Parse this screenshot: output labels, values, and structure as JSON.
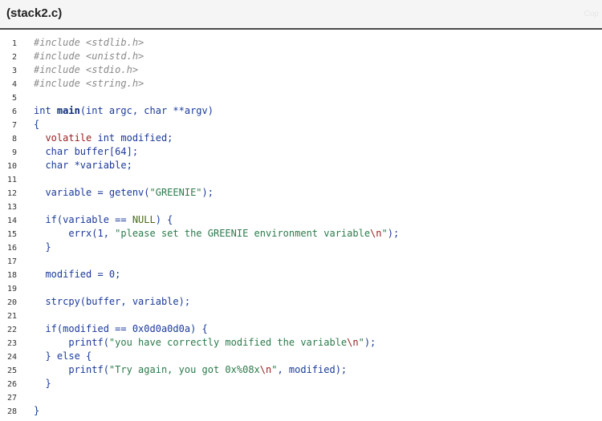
{
  "window": {
    "title": "(stack2.c)",
    "corner_label": "Cop"
  },
  "colors": {
    "keyword": "#1b3a9a",
    "preprocessor": "#8a8a8a",
    "string": "#2b7a4b",
    "escape": "#9b1c1c",
    "volatile": "#9b1c1c"
  },
  "code": {
    "lines": [
      {
        "num": "1",
        "tokens": [
          {
            "t": "#include <stdlib.h>",
            "c": "pp"
          }
        ]
      },
      {
        "num": "2",
        "tokens": [
          {
            "t": "#include <unistd.h>",
            "c": "pp"
          }
        ]
      },
      {
        "num": "3",
        "tokens": [
          {
            "t": "#include <stdio.h>",
            "c": "pp"
          }
        ]
      },
      {
        "num": "4",
        "tokens": [
          {
            "t": "#include <string.h>",
            "c": "pp"
          }
        ]
      },
      {
        "num": "5",
        "tokens": []
      },
      {
        "num": "6",
        "tokens": [
          {
            "t": "int ",
            "c": "kw"
          },
          {
            "t": "main",
            "c": "fn"
          },
          {
            "t": "(int argc, char **argv)",
            "c": "plain"
          }
        ]
      },
      {
        "num": "7",
        "tokens": [
          {
            "t": "{",
            "c": "plain"
          }
        ]
      },
      {
        "num": "8",
        "tokens": [
          {
            "t": "  ",
            "c": "plain"
          },
          {
            "t": "volatile",
            "c": "kwred"
          },
          {
            "t": " int modified;",
            "c": "plain"
          }
        ]
      },
      {
        "num": "9",
        "tokens": [
          {
            "t": "  char buffer[64];",
            "c": "plain"
          }
        ]
      },
      {
        "num": "10",
        "tokens": [
          {
            "t": "  char *variable;",
            "c": "plain"
          }
        ]
      },
      {
        "num": "11",
        "tokens": []
      },
      {
        "num": "12",
        "tokens": [
          {
            "t": "  variable = getenv(",
            "c": "plain"
          },
          {
            "t": "\"GREENIE\"",
            "c": "str"
          },
          {
            "t": ");",
            "c": "plain"
          }
        ]
      },
      {
        "num": "13",
        "tokens": []
      },
      {
        "num": "14",
        "tokens": [
          {
            "t": "  if(variable == ",
            "c": "plain"
          },
          {
            "t": "NULL",
            "c": "null"
          },
          {
            "t": ") {",
            "c": "plain"
          }
        ]
      },
      {
        "num": "15",
        "tokens": [
          {
            "t": "      errx(1, ",
            "c": "plain"
          },
          {
            "t": "\"please set the GREENIE environment variable",
            "c": "str"
          },
          {
            "t": "\\n",
            "c": "esc"
          },
          {
            "t": "\"",
            "c": "str"
          },
          {
            "t": ");",
            "c": "plain"
          }
        ]
      },
      {
        "num": "16",
        "tokens": [
          {
            "t": "  }",
            "c": "plain"
          }
        ]
      },
      {
        "num": "17",
        "tokens": []
      },
      {
        "num": "18",
        "tokens": [
          {
            "t": "  modified = 0;",
            "c": "plain"
          }
        ]
      },
      {
        "num": "19",
        "tokens": []
      },
      {
        "num": "20",
        "tokens": [
          {
            "t": "  strcpy(buffer, variable);",
            "c": "plain"
          }
        ]
      },
      {
        "num": "21",
        "tokens": []
      },
      {
        "num": "22",
        "tokens": [
          {
            "t": "  if(modified == 0x0d0a0d0a) {",
            "c": "plain"
          }
        ]
      },
      {
        "num": "23",
        "tokens": [
          {
            "t": "      printf(",
            "c": "plain"
          },
          {
            "t": "\"you have correctly modified the variable",
            "c": "str"
          },
          {
            "t": "\\n",
            "c": "esc"
          },
          {
            "t": "\"",
            "c": "str"
          },
          {
            "t": ");",
            "c": "plain"
          }
        ]
      },
      {
        "num": "24",
        "tokens": [
          {
            "t": "  } else {",
            "c": "plain"
          }
        ]
      },
      {
        "num": "25",
        "tokens": [
          {
            "t": "      printf(",
            "c": "plain"
          },
          {
            "t": "\"Try again, you got 0x%08x",
            "c": "str"
          },
          {
            "t": "\\n",
            "c": "esc"
          },
          {
            "t": "\"",
            "c": "str"
          },
          {
            "t": ", modified);",
            "c": "plain"
          }
        ]
      },
      {
        "num": "26",
        "tokens": [
          {
            "t": "  }",
            "c": "plain"
          }
        ]
      },
      {
        "num": "27",
        "tokens": []
      },
      {
        "num": "28",
        "tokens": [
          {
            "t": "}",
            "c": "plain"
          }
        ]
      }
    ]
  }
}
